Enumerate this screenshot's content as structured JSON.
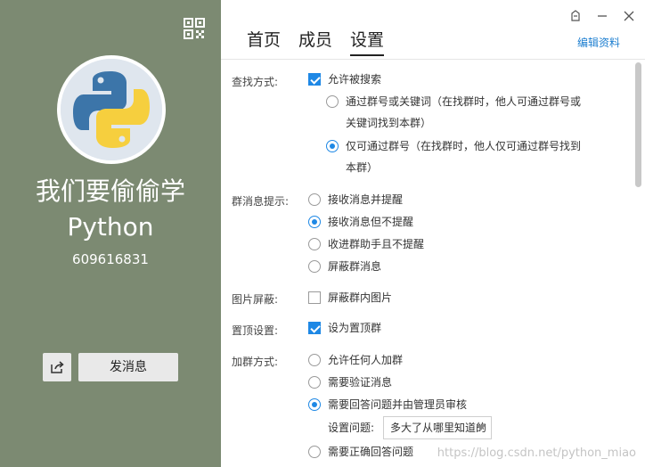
{
  "left": {
    "group_name_line1": "我们要偷偷学",
    "group_name_line2": "Python",
    "group_id": "609616831",
    "send_label": "发消息",
    "qr_icon": "qr-code-icon",
    "share_icon": "share-icon",
    "bg_color": "#7c8a72"
  },
  "window": {
    "controls": [
      "skin-icon",
      "minimize-icon",
      "close-icon"
    ]
  },
  "tabs": [
    {
      "label": "首页",
      "active": false
    },
    {
      "label": "成员",
      "active": false
    },
    {
      "label": "设置",
      "active": true
    }
  ],
  "edit_label": "编辑资料",
  "settings": {
    "search": {
      "label": "查找方式:",
      "allow": {
        "label": "允许被搜索",
        "checked": true
      },
      "opt1_line1": "通过群号或关键词（在找群时，他人可通过群号或",
      "opt1_line2": "关键词找到本群）",
      "opt2_line1": "仅可通过群号（在找群时，他人仅可通过群号找到",
      "opt2_line2": "本群）",
      "selected": 2
    },
    "notify": {
      "label": "群消息提示:",
      "options": [
        "接收消息并提醒",
        "接收消息但不提醒",
        "收进群助手且不提醒",
        "屏蔽群消息"
      ],
      "selected": 2
    },
    "image_block": {
      "label": "图片屏蔽:",
      "option": "屏蔽群内图片",
      "checked": false
    },
    "pin": {
      "label": "置顶设置:",
      "option": "设为置顶群",
      "checked": true
    },
    "join": {
      "label": "加群方式:",
      "options": [
        "允许任何人加群",
        "需要验证消息",
        "需要回答问题并由管理员审核",
        "需要正确回答问题"
      ],
      "selected": 3,
      "question_label": "设置问题:",
      "question_value": "多大了从哪里知道的"
    }
  },
  "watermark": "https://blog.csdn.net/python_miao",
  "accent_color": "#1e88e5"
}
